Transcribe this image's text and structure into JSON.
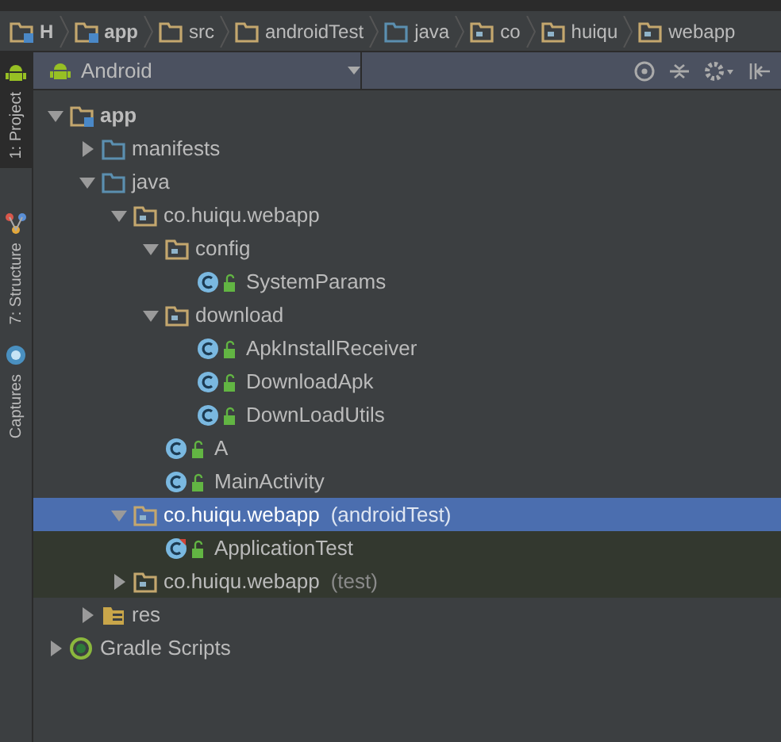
{
  "breadcrumbs": [
    {
      "label": "H",
      "kind": "module"
    },
    {
      "label": "app",
      "kind": "module"
    },
    {
      "label": "src",
      "kind": "folder"
    },
    {
      "label": "androidTest",
      "kind": "folder"
    },
    {
      "label": "java",
      "kind": "source"
    },
    {
      "label": "co",
      "kind": "package"
    },
    {
      "label": "huiqu",
      "kind": "package"
    },
    {
      "label": "webapp",
      "kind": "package"
    }
  ],
  "side_tabs": [
    {
      "label": "1: Project",
      "kind": "android",
      "selected": true
    },
    {
      "label": "7: Structure",
      "kind": "structure",
      "selected": false
    },
    {
      "label": "Captures",
      "kind": "captures",
      "selected": false
    }
  ],
  "view_selector": {
    "label": "Android"
  },
  "tree": [
    {
      "label": "app",
      "kind": "module",
      "expanded": true,
      "selected": false,
      "children": [
        {
          "label": "manifests",
          "kind": "source",
          "expanded": false,
          "selected": false
        },
        {
          "label": "java",
          "kind": "source",
          "expanded": true,
          "selected": false,
          "children": [
            {
              "label": "co.huiqu.webapp",
              "kind": "package",
              "test": false,
              "expanded": true,
              "selected": false,
              "children": [
                {
                  "label": "config",
                  "kind": "package",
                  "test": false,
                  "expanded": true,
                  "selected": false,
                  "children": [
                    {
                      "label": "SystemParams",
                      "kind": "class",
                      "selected": false
                    }
                  ]
                },
                {
                  "label": "download",
                  "kind": "package",
                  "test": false,
                  "expanded": true,
                  "selected": false,
                  "children": [
                    {
                      "label": "ApkInstallReceiver",
                      "kind": "class",
                      "selected": false
                    },
                    {
                      "label": "DownloadApk",
                      "kind": "class",
                      "selected": false
                    },
                    {
                      "label": "DownLoadUtils",
                      "kind": "class",
                      "selected": false
                    }
                  ]
                },
                {
                  "label": "A",
                  "kind": "class",
                  "selected": false
                },
                {
                  "label": "MainActivity",
                  "kind": "class",
                  "selected": false
                }
              ]
            },
            {
              "label": "co.huiqu.webapp",
              "suffix": "(androidTest)",
              "kind": "package",
              "test": true,
              "expanded": true,
              "selected": true,
              "children": [
                {
                  "label": "ApplicationTest",
                  "kind": "test-class",
                  "selected": false
                }
              ]
            },
            {
              "label": "co.huiqu.webapp",
              "suffix": "(test)",
              "kind": "package",
              "test": true,
              "expanded": false,
              "selected": false
            }
          ]
        },
        {
          "label": "res",
          "kind": "res",
          "expanded": false,
          "selected": false
        }
      ]
    },
    {
      "label": "Gradle Scripts",
      "kind": "gradle",
      "expanded": false,
      "selected": false
    }
  ]
}
